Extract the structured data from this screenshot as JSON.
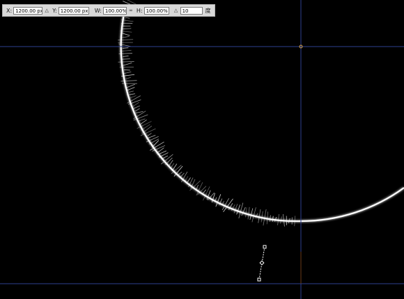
{
  "toolbar": {
    "x_label": "X:",
    "x_value": "1200.00 px",
    "y_label": "Y:",
    "y_value": "1200.00 px",
    "w_label": "W:",
    "w_value": "100.00%",
    "h_label": "H:",
    "h_value": "100.00%",
    "angle_value": "10",
    "angle_unit": "度",
    "icons": {
      "reference": "triangle-delta-icon",
      "link": "chain-link-icon",
      "angle": "rotation-angle-icon"
    }
  },
  "colors": {
    "background": "#000000",
    "guide": "#2e3f8f",
    "ring": "#ffffff",
    "toolbar_bg": "#d8d8d8",
    "anchor": "#d8a040"
  }
}
